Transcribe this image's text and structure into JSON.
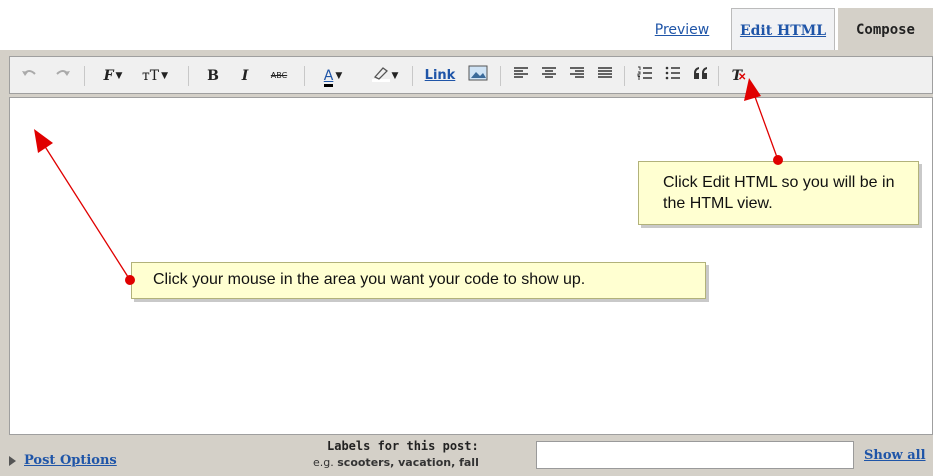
{
  "tabs": {
    "preview": "Preview",
    "edit_html": "Edit HTML",
    "compose": "Compose"
  },
  "toolbar": {
    "font_glyph": "F",
    "size_glyph": "тT",
    "bold": "B",
    "italic": "I",
    "strike": "ABC",
    "text_color_glyph": "A",
    "link": "Link"
  },
  "bottom": {
    "post_options": "Post Options",
    "labels_title": "Labels for this post:",
    "labels_example_prefix": "e.g. ",
    "labels_example_values": "scooters, vacation, fall",
    "show_all": "Show all"
  },
  "callouts": {
    "edit_html_hint": "Click Edit HTML so you will be in the HTML view.",
    "click_area_hint": "Click your mouse in the area you want your code to show up."
  },
  "colors": {
    "tab_link": "#1f55a8",
    "frame": "#d4d0c8",
    "callout_bg": "#ffffd1",
    "arrow": "#e00000"
  }
}
